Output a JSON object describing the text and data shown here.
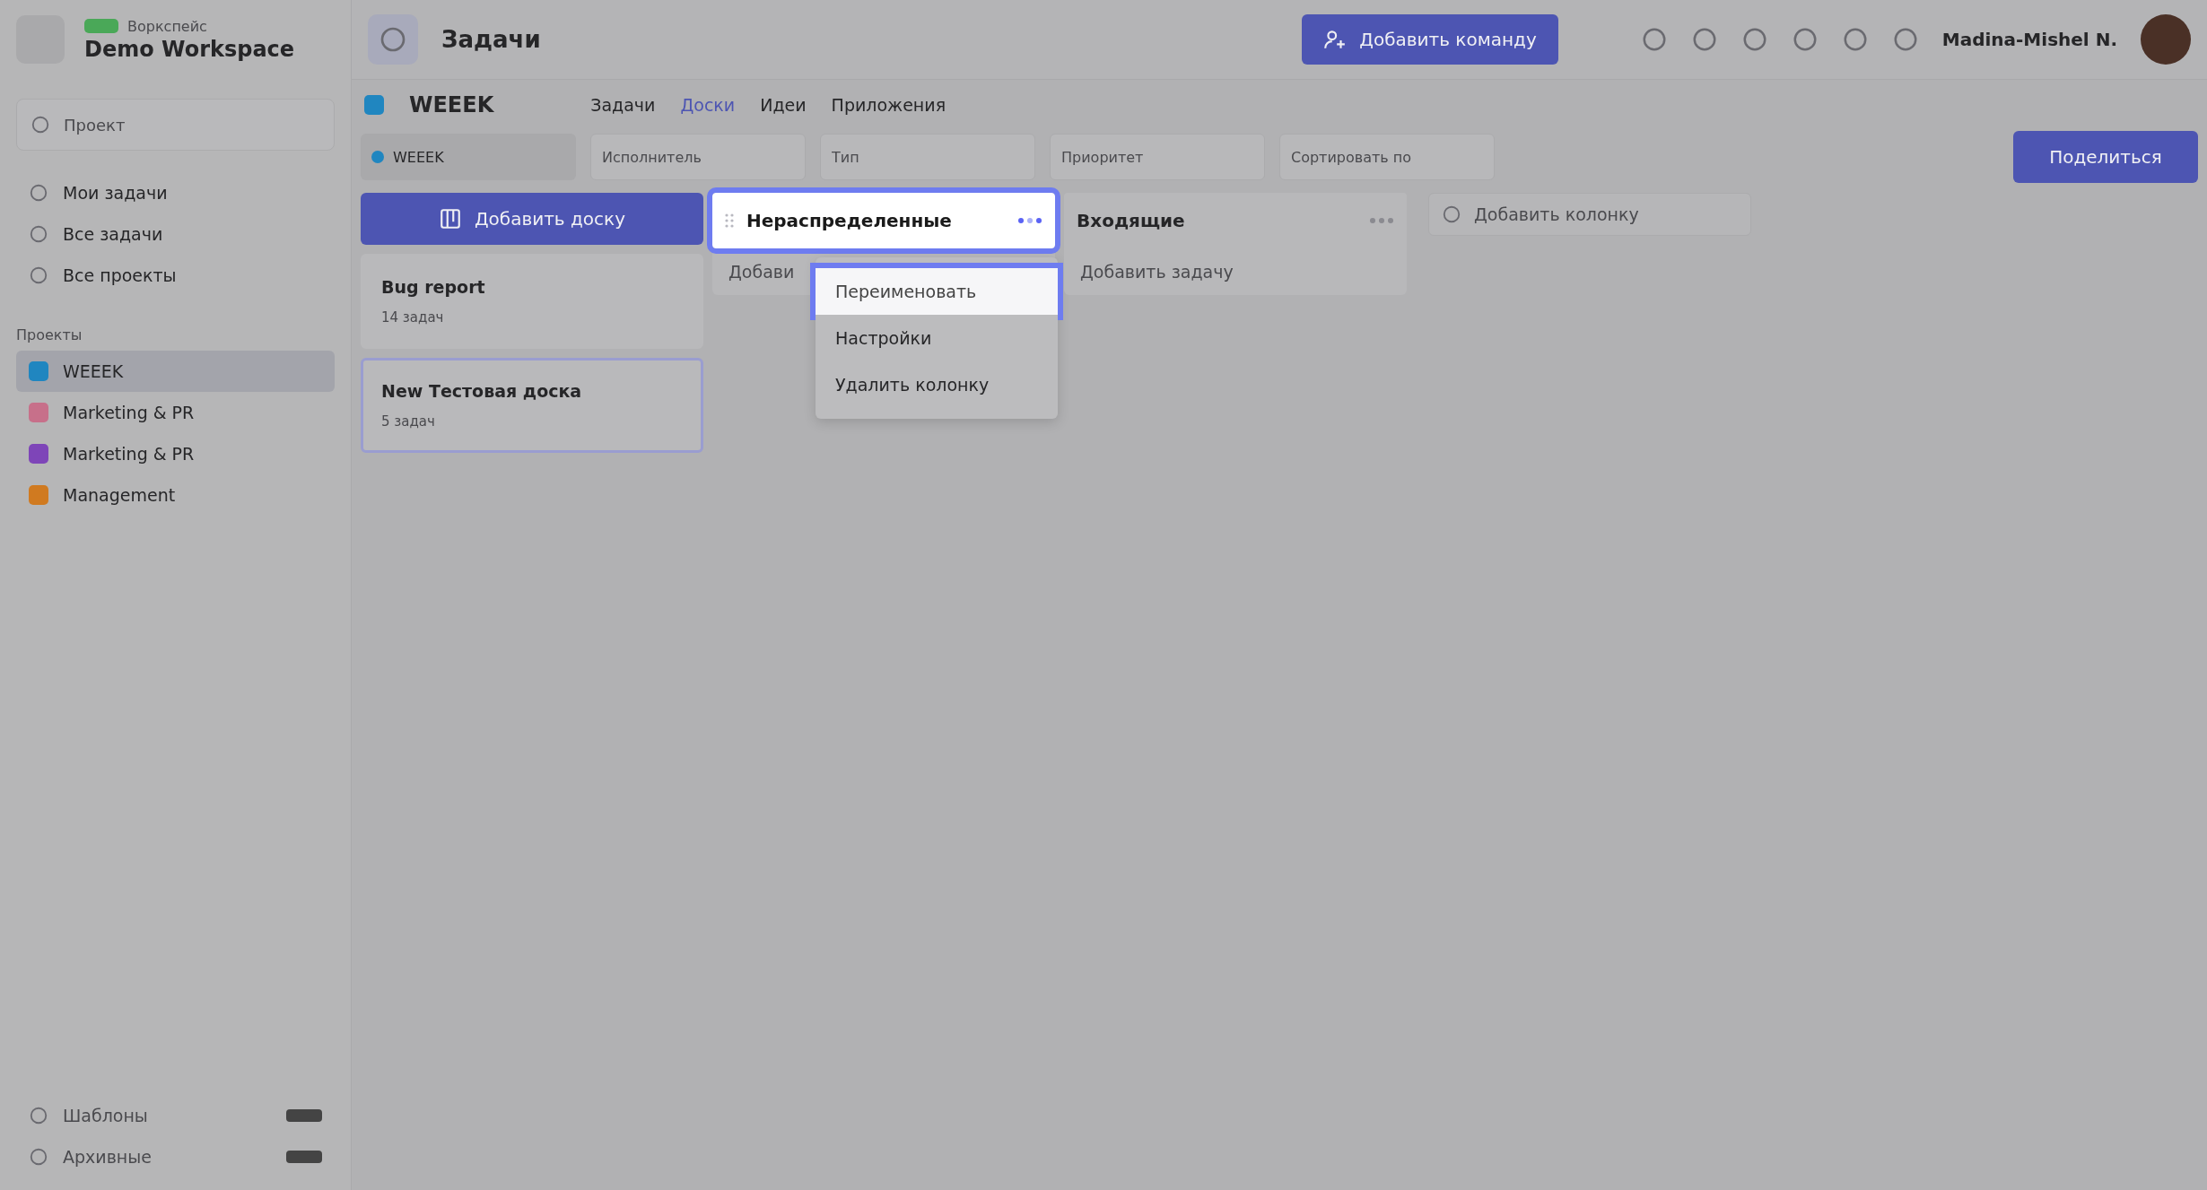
{
  "sidebar": {
    "workspace_label": "Воркспейс",
    "workspace": "Demo Workspace",
    "search": {
      "placeholder": "Проект"
    },
    "nav": [
      {
        "label": "Мои задачи"
      },
      {
        "label": "Все задачи"
      },
      {
        "label": "Все проекты"
      }
    ],
    "projects_title": "Проекты",
    "projects": [
      {
        "label": "WEEEK",
        "color": "#2086c0",
        "selected": true
      },
      {
        "label": "Marketing & PR",
        "color": "#c7708a",
        "selected": false
      },
      {
        "label": "Marketing & PR",
        "color": "#7e45b8",
        "selected": false
      },
      {
        "label": "Management",
        "color": "#d07a20",
        "selected": false
      }
    ],
    "footer": [
      {
        "label": "Шаблоны"
      },
      {
        "label": "Архивные"
      }
    ]
  },
  "topbar": {
    "title": "Задачи",
    "add_team": "Добавить команду",
    "user": "Madina-Mishel N."
  },
  "project": {
    "name": "WEEEK",
    "color": "#2086c0",
    "tabs": [
      {
        "label": "Задачи",
        "selected": false
      },
      {
        "label": "Доски",
        "selected": true
      },
      {
        "label": "Идеи",
        "selected": false
      },
      {
        "label": "Приложения",
        "selected": false
      }
    ],
    "chip": "WEEEK",
    "filters": [
      {
        "placeholder": "Исполнитель"
      },
      {
        "placeholder": "Тип"
      },
      {
        "placeholder": "Приоритет"
      },
      {
        "placeholder": "Сортировать по"
      }
    ],
    "share": "Поделиться"
  },
  "boards": {
    "add": "Добавить доску",
    "items": [
      {
        "title": "Bug report",
        "count": "14 задач",
        "selected": false
      },
      {
        "title": "New Тестовая доска",
        "count": "5 задач",
        "selected": true
      }
    ]
  },
  "columns": [
    {
      "title": "Нераспределенные",
      "add_task": "Добави",
      "highlighted": true,
      "menu": [
        {
          "label": "Переименовать",
          "highlighted": true
        },
        {
          "label": "Настройки",
          "highlighted": false
        },
        {
          "label": "Удалить колонку",
          "highlighted": false
        }
      ]
    },
    {
      "title": "Входящие",
      "add_task": "Добавить задачу",
      "highlighted": false
    }
  ],
  "add_column": "Добавить колонку"
}
